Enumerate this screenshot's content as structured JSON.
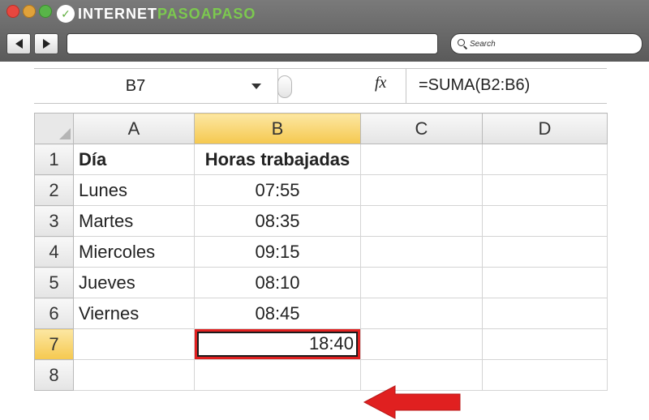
{
  "browser": {
    "logo": {
      "prefix": "INTERNET",
      "accent": "PASOAPASO"
    },
    "search_placeholder": "Search"
  },
  "excel": {
    "name_box": "B7",
    "formula": "=SUMA(B2:B6)",
    "fx_label": "fx",
    "columns": [
      "A",
      "B",
      "C",
      "D"
    ],
    "selected_column": "B",
    "rows": [
      {
        "n": "1",
        "a": "Día",
        "b": "Horas trabajadas"
      },
      {
        "n": "2",
        "a": "Lunes",
        "b": "07:55"
      },
      {
        "n": "3",
        "a": "Martes",
        "b": "08:35"
      },
      {
        "n": "4",
        "a": "Miercoles",
        "b": "09:15"
      },
      {
        "n": "5",
        "a": "Jueves",
        "b": "08:10"
      },
      {
        "n": "6",
        "a": "Viernes",
        "b": "08:45"
      },
      {
        "n": "7",
        "a": "",
        "b": "18:40"
      },
      {
        "n": "8",
        "a": "",
        "b": ""
      }
    ],
    "selected_row": "7",
    "highlight_color": "#e02020"
  }
}
